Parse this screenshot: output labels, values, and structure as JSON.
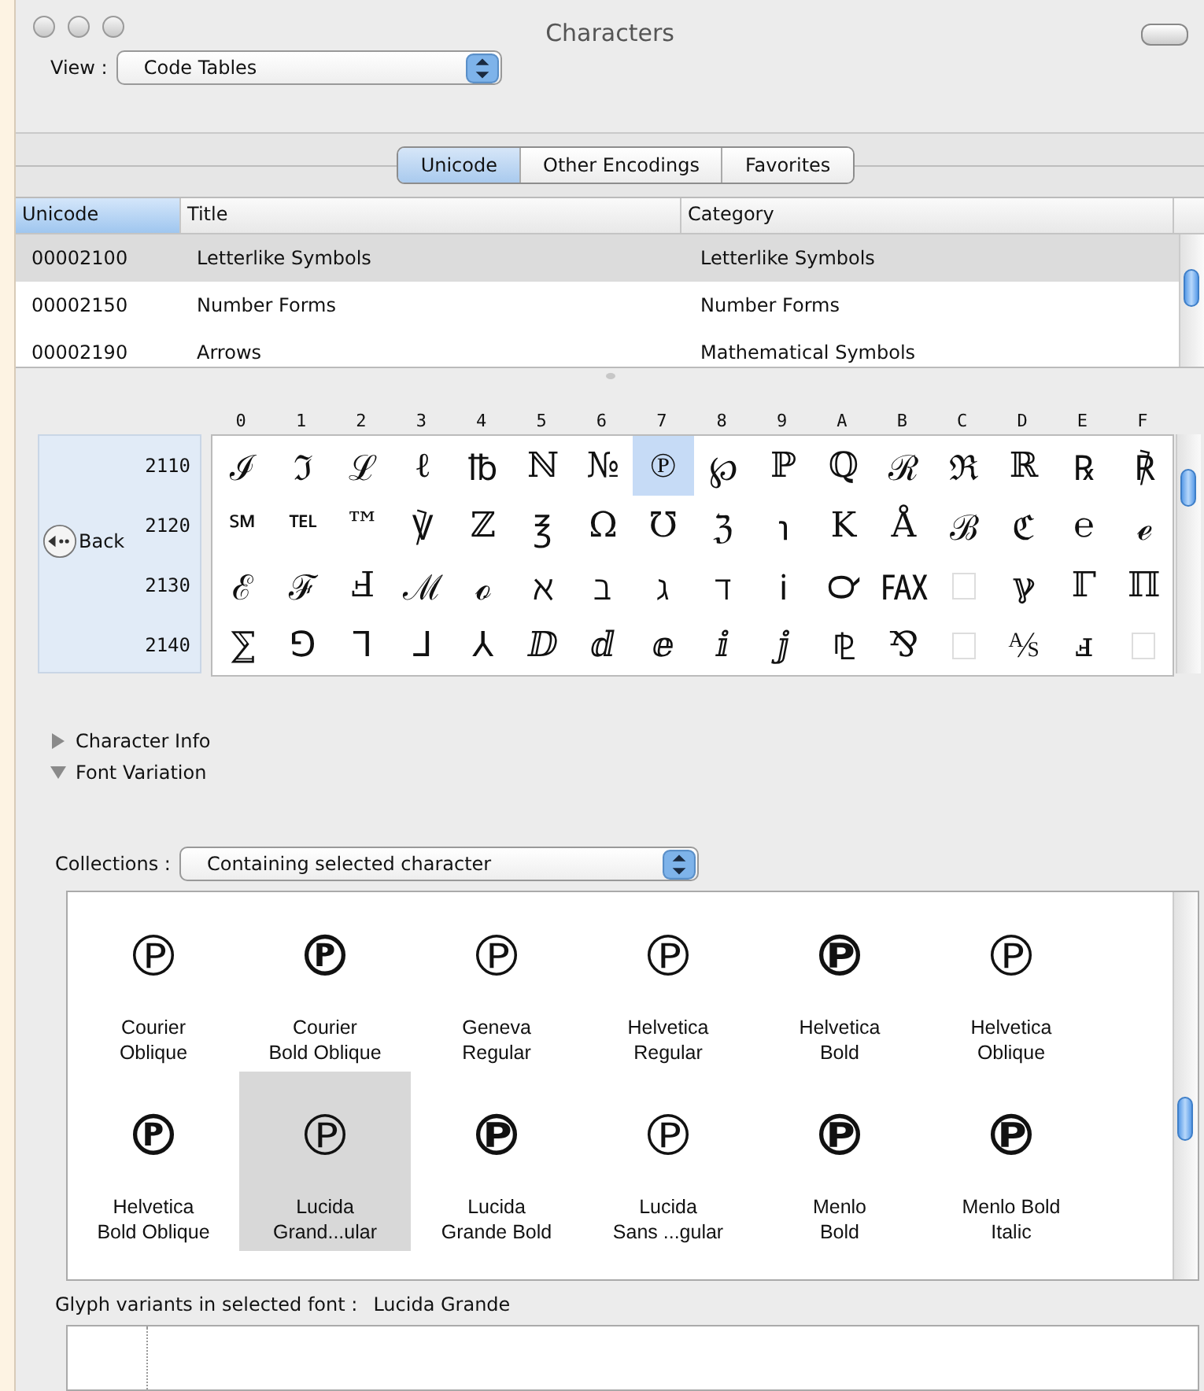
{
  "window": {
    "title": "Characters"
  },
  "view": {
    "label": "View :",
    "value": "Code Tables"
  },
  "tabs": [
    {
      "label": "Unicode",
      "selected": true
    },
    {
      "label": "Other Encodings",
      "selected": false
    },
    {
      "label": "Favorites",
      "selected": false
    }
  ],
  "table": {
    "columns": [
      {
        "label": "Unicode",
        "selected": true
      },
      {
        "label": "Title",
        "selected": false
      },
      {
        "label": "Category",
        "selected": false
      }
    ],
    "rows": [
      {
        "code": "00002100",
        "title": "Letterlike Symbols",
        "category": "Letterlike Symbols",
        "selected": true
      },
      {
        "code": "00002150",
        "title": "Number Forms",
        "category": "Number Forms",
        "selected": false
      },
      {
        "code": "00002190",
        "title": "Arrows",
        "category": "Mathematical Symbols",
        "selected": false
      }
    ]
  },
  "back_button": {
    "label": "Back"
  },
  "char_grid": {
    "columns": [
      "0",
      "1",
      "2",
      "3",
      "4",
      "5",
      "6",
      "7",
      "8",
      "9",
      "A",
      "B",
      "C",
      "D",
      "E",
      "F"
    ],
    "rows": [
      {
        "label": "2110",
        "cells": [
          {
            "kind": "glyph",
            "text": "ℐ",
            "selected": false
          },
          {
            "kind": "glyph",
            "text": "ℑ",
            "selected": false
          },
          {
            "kind": "glyph",
            "text": "ℒ",
            "selected": false
          },
          {
            "kind": "glyph",
            "text": "ℓ",
            "selected": false
          },
          {
            "kind": "glyph",
            "text": "℔",
            "selected": false
          },
          {
            "kind": "glyph",
            "text": "ℕ",
            "selected": false
          },
          {
            "kind": "glyph",
            "text": "№",
            "selected": false
          },
          {
            "kind": "glyph",
            "text": "℗",
            "selected": true
          },
          {
            "kind": "glyph",
            "text": "℘",
            "selected": false
          },
          {
            "kind": "glyph",
            "text": "ℙ",
            "selected": false
          },
          {
            "kind": "glyph",
            "text": "ℚ",
            "selected": false
          },
          {
            "kind": "glyph",
            "text": "ℛ",
            "selected": false
          },
          {
            "kind": "glyph",
            "text": "ℜ",
            "selected": false
          },
          {
            "kind": "glyph",
            "text": "ℝ",
            "selected": false
          },
          {
            "kind": "glyph",
            "text": "℞",
            "selected": false
          },
          {
            "kind": "glyph",
            "text": "℟",
            "selected": false
          }
        ]
      },
      {
        "label": "2120",
        "cells": [
          {
            "kind": "glyph",
            "text": "℠",
            "selected": false
          },
          {
            "kind": "glyph",
            "text": "℡",
            "selected": false
          },
          {
            "kind": "glyph",
            "text": "™",
            "selected": false
          },
          {
            "kind": "glyph",
            "text": "℣",
            "selected": false
          },
          {
            "kind": "glyph",
            "text": "ℤ",
            "selected": false
          },
          {
            "kind": "glyph",
            "text": "℥",
            "selected": false
          },
          {
            "kind": "glyph",
            "text": "Ω",
            "selected": false
          },
          {
            "kind": "glyph",
            "text": "℧",
            "selected": false
          },
          {
            "kind": "glyph",
            "text": "ℨ",
            "selected": false
          },
          {
            "kind": "glyph",
            "text": "℩",
            "selected": false
          },
          {
            "kind": "glyph",
            "text": "K",
            "selected": false
          },
          {
            "kind": "glyph",
            "text": "Å",
            "selected": false
          },
          {
            "kind": "glyph",
            "text": "ℬ",
            "selected": false
          },
          {
            "kind": "glyph",
            "text": "ℭ",
            "selected": false
          },
          {
            "kind": "glyph",
            "text": "℮",
            "selected": false
          },
          {
            "kind": "glyph",
            "text": "ℯ",
            "selected": false
          }
        ]
      },
      {
        "label": "2130",
        "cells": [
          {
            "kind": "glyph",
            "text": "ℰ",
            "selected": false
          },
          {
            "kind": "glyph",
            "text": "ℱ",
            "selected": false
          },
          {
            "kind": "glyph",
            "text": "Ⅎ",
            "selected": false
          },
          {
            "kind": "glyph",
            "text": "ℳ",
            "selected": false
          },
          {
            "kind": "glyph",
            "text": "ℴ",
            "selected": false
          },
          {
            "kind": "glyph",
            "text": "ℵ",
            "selected": false
          },
          {
            "kind": "glyph",
            "text": "ℶ",
            "selected": false
          },
          {
            "kind": "glyph",
            "text": "ℷ",
            "selected": false
          },
          {
            "kind": "glyph",
            "text": "ℸ",
            "selected": false
          },
          {
            "kind": "glyph",
            "text": "ℹ",
            "selected": false
          },
          {
            "kind": "glyph",
            "text": "℺",
            "selected": false
          },
          {
            "kind": "glyph",
            "text": "℻",
            "selected": false
          },
          {
            "kind": "empty",
            "selected": false
          },
          {
            "kind": "glyph",
            "text": "ℽ",
            "selected": false
          },
          {
            "kind": "glyph",
            "text": "ℾ",
            "selected": false
          },
          {
            "kind": "glyph",
            "text": "ℿ",
            "selected": false
          }
        ]
      },
      {
        "label": "2140",
        "cells": [
          {
            "kind": "glyph",
            "text": "⅀",
            "selected": false
          },
          {
            "kind": "glyph",
            "text": "⅁",
            "selected": false
          },
          {
            "kind": "glyph",
            "text": "⅂",
            "selected": false
          },
          {
            "kind": "glyph",
            "text": "⅃",
            "selected": false
          },
          {
            "kind": "glyph",
            "text": "⅄",
            "selected": false
          },
          {
            "kind": "glyph",
            "text": "ⅅ",
            "selected": false
          },
          {
            "kind": "glyph",
            "text": "ⅆ",
            "selected": false
          },
          {
            "kind": "glyph",
            "text": "ⅇ",
            "selected": false
          },
          {
            "kind": "glyph",
            "text": "ⅈ",
            "selected": false
          },
          {
            "kind": "glyph",
            "text": "ⅉ",
            "selected": false
          },
          {
            "kind": "glyph",
            "text": "⅊",
            "selected": false
          },
          {
            "kind": "glyph",
            "text": "⅋",
            "selected": false
          },
          {
            "kind": "empty",
            "selected": false
          },
          {
            "kind": "glyph",
            "text": "⅍",
            "selected": false
          },
          {
            "kind": "glyph",
            "text": "ⅎ",
            "selected": false
          },
          {
            "kind": "empty",
            "selected": false
          }
        ]
      }
    ]
  },
  "sections": [
    {
      "label": "Character Info",
      "expanded": false
    },
    {
      "label": "Font Variation",
      "expanded": true
    }
  ],
  "collections": {
    "label": "Collections :",
    "value": "Containing selected character"
  },
  "fonts": [
    {
      "glyph": "℗",
      "kind": "oblique",
      "line1": "Courier",
      "line2": "Oblique",
      "selected": false
    },
    {
      "glyph": "℗",
      "kind": "bold-oblique",
      "line1": "Courier",
      "line2": "Bold Oblique",
      "selected": false
    },
    {
      "glyph": "℗",
      "kind": "regular",
      "line1": "Geneva",
      "line2": "Regular",
      "selected": false
    },
    {
      "glyph": "℗",
      "kind": "regular",
      "line1": "Helvetica",
      "line2": "Regular",
      "selected": false
    },
    {
      "glyph": "℗",
      "kind": "bold",
      "line1": "Helvetica",
      "line2": "Bold",
      "selected": false
    },
    {
      "glyph": "℗",
      "kind": "oblique",
      "line1": "Helvetica",
      "line2": "Oblique",
      "selected": false
    },
    {
      "glyph": "℗",
      "kind": "bold-oblique",
      "line1": "Helvetica",
      "line2": "Bold Oblique",
      "selected": false
    },
    {
      "glyph": "℗",
      "kind": "regular",
      "line1": "Lucida",
      "line2": "Grand...ular",
      "selected": true
    },
    {
      "glyph": "℗",
      "kind": "bold",
      "line1": "Lucida",
      "line2": "Grande Bold",
      "selected": false
    },
    {
      "glyph": "℗",
      "kind": "regular",
      "line1": "Lucida",
      "line2": "Sans ...gular",
      "selected": false
    },
    {
      "glyph": "℗",
      "kind": "bold",
      "line1": "Menlo",
      "line2": "Bold",
      "selected": false
    },
    {
      "glyph": "℗",
      "kind": "bold",
      "line1": "Menlo Bold",
      "line2": "Italic",
      "selected": false
    }
  ],
  "glyph_variants": {
    "label": "Glyph variants in selected font :",
    "font": "Lucida Grande"
  }
}
